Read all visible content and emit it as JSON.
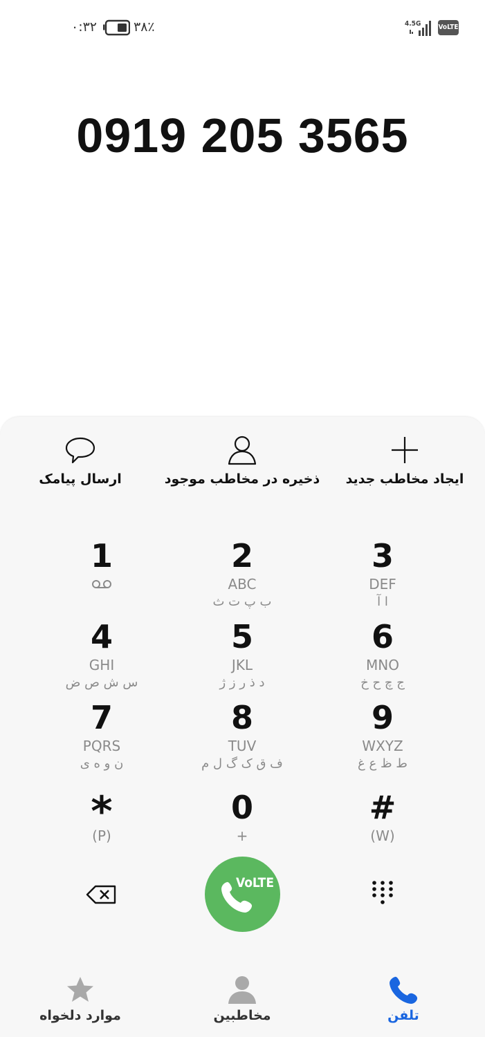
{
  "status_bar": {
    "time": "۰:۳۲",
    "battery_percent": "۳۸٪",
    "network": "4.5G",
    "volte": "VoLTE"
  },
  "dialed_number": "0919 205 3565",
  "actions": [
    {
      "label": "ایجاد مخاطب جدید",
      "icon": "plus-icon"
    },
    {
      "label": "ذخیره در مخاطب موجود",
      "icon": "person-icon"
    },
    {
      "label": "ارسال پیامک",
      "icon": "message-icon"
    }
  ],
  "keypad": [
    {
      "digit": "1",
      "latin": "",
      "farsi": "",
      "icon": "voicemail-icon"
    },
    {
      "digit": "2",
      "latin": "ABC",
      "farsi": "ب پ ت ث"
    },
    {
      "digit": "3",
      "latin": "DEF",
      "farsi": "ا آ"
    },
    {
      "digit": "4",
      "latin": "GHI",
      "farsi": "س ش ص ض"
    },
    {
      "digit": "5",
      "latin": "JKL",
      "farsi": "د ذ ر ز ژ"
    },
    {
      "digit": "6",
      "latin": "MNO",
      "farsi": "ج چ ح خ"
    },
    {
      "digit": "7",
      "latin": "PQRS",
      "farsi": "ن و ه ی"
    },
    {
      "digit": "8",
      "latin": "TUV",
      "farsi": "ف ق ک گ ل م"
    },
    {
      "digit": "9",
      "latin": "WXYZ",
      "farsi": "ط ظ ع غ"
    },
    {
      "digit": "*",
      "latin": "(P)",
      "farsi": ""
    },
    {
      "digit": "0",
      "latin": "+",
      "farsi": ""
    },
    {
      "digit": "#",
      "latin": "(W)",
      "farsi": ""
    }
  ],
  "call_button": {
    "label": "VoLTE",
    "color": "#5bb85f"
  },
  "nav": [
    {
      "label": "موارد دلخواه",
      "icon": "star-icon"
    },
    {
      "label": "مخاطبین",
      "icon": "contacts-icon"
    },
    {
      "label": "تلفن",
      "icon": "phone-icon",
      "active": true
    }
  ],
  "colors": {
    "accent": "#1a66e0",
    "call_green": "#5bb85f"
  }
}
